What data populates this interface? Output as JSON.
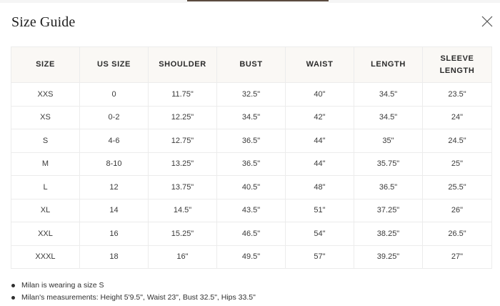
{
  "modal": {
    "title": "Size Guide",
    "close_icon": "close-icon"
  },
  "table": {
    "headers": [
      "SIZE",
      "US SIZE",
      "SHOULDER",
      "BUST",
      "WAIST",
      "LENGTH",
      "SLEEVE LENGTH"
    ],
    "header_lines": [
      [
        "SIZE"
      ],
      [
        "US SIZE"
      ],
      [
        "SHOULDER"
      ],
      [
        "BUST"
      ],
      [
        "WAIST"
      ],
      [
        "LENGTH"
      ],
      [
        "SLEEVE",
        "LENGTH"
      ]
    ],
    "rows": [
      [
        "XXS",
        "0",
        "11.75\"",
        "32.5\"",
        "40\"",
        "34.5\"",
        "23.5\""
      ],
      [
        "XS",
        "0-2",
        "12.25\"",
        "34.5\"",
        "42\"",
        "34.5\"",
        "24\""
      ],
      [
        "S",
        "4-6",
        "12.75\"",
        "36.5\"",
        "44\"",
        "35\"",
        "24.5\""
      ],
      [
        "M",
        "8-10",
        "13.25\"",
        "36.5\"",
        "44\"",
        "35.75\"",
        "25\""
      ],
      [
        "L",
        "12",
        "13.75\"",
        "40.5\"",
        "48\"",
        "36.5\"",
        "25.5\""
      ],
      [
        "XL",
        "14",
        "14.5\"",
        "43.5\"",
        "51\"",
        "37.25\"",
        "26\""
      ],
      [
        "XXL",
        "16",
        "15.25\"",
        "46.5\"",
        "54\"",
        "38.25\"",
        "26.5\""
      ],
      [
        "XXXL",
        "18",
        "16\"",
        "49.5\"",
        "57\"",
        "39.25\"",
        "27\""
      ]
    ]
  },
  "notes": [
    "Milan is wearing a size S",
    "Milan's measurements: Height 5'9.5\", Waist 23\", Bust 32.5\", Hips 33.5\""
  ],
  "colors": {
    "header_background": "#faf8f5",
    "border": "#ececec",
    "text": "#2b2b2b"
  }
}
